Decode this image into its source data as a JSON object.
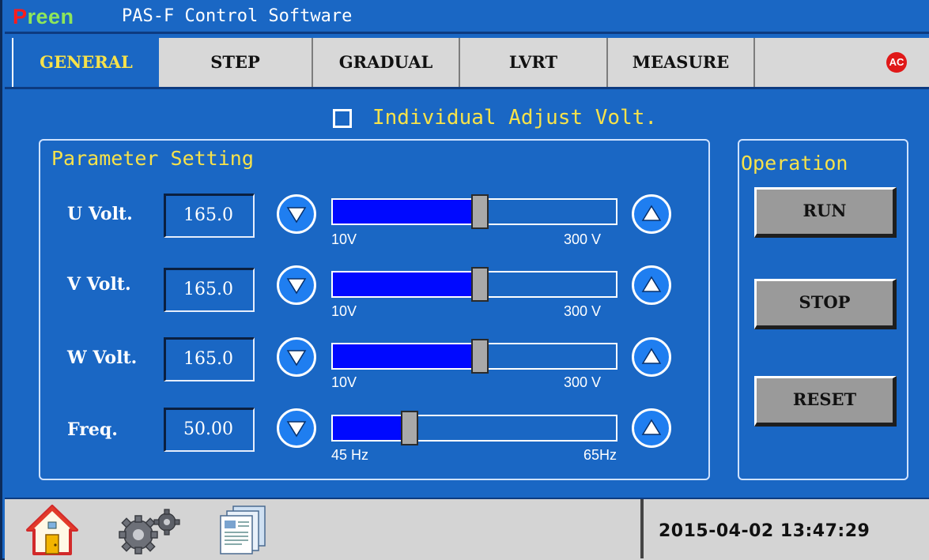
{
  "titlebar": {
    "brand_first_letter": "P",
    "brand_rest": "reen",
    "app_title": "PAS-F Control Software"
  },
  "tabs": [
    {
      "label": "GENERAL",
      "active": true
    },
    {
      "label": "STEP",
      "active": false
    },
    {
      "label": "GRADUAL",
      "active": false
    },
    {
      "label": "LVRT",
      "active": false
    },
    {
      "label": "MEASURE",
      "active": false
    }
  ],
  "ac_badge": "AC",
  "individual_adjust": {
    "label": "Individual Adjust Volt.",
    "checked": false
  },
  "parameter_setting": {
    "title": "Parameter Setting",
    "rows": [
      {
        "label": "U Volt.",
        "value": "165.0",
        "min_label": "10V",
        "max_label": "300 V",
        "level": 0.52
      },
      {
        "label": "V Volt.",
        "value": "165.0",
        "min_label": "10V",
        "max_label": "300 V",
        "level": 0.52
      },
      {
        "label": "W Volt.",
        "value": "165.0",
        "min_label": "10V",
        "max_label": "300 V",
        "level": 0.52
      },
      {
        "label": "Freq.",
        "value": "50.00",
        "min_label": "45 Hz",
        "max_label": "65Hz",
        "level": 0.27
      }
    ]
  },
  "operation": {
    "title": "Operation",
    "run_label": "RUN",
    "stop_label": "STOP",
    "reset_label": "RESET"
  },
  "statusbar": {
    "datetime": "2015-04-02  13:47:29",
    "icons": [
      "home-icon",
      "settings-gears-icon",
      "documents-icon"
    ]
  },
  "colors": {
    "background": "#1a67c4",
    "accent_text": "#f7e24a",
    "slider_fill": "#0009ff",
    "brand_p": "#ff1b1b",
    "brand_reen": "#8ee65a",
    "badge": "#e01818"
  }
}
